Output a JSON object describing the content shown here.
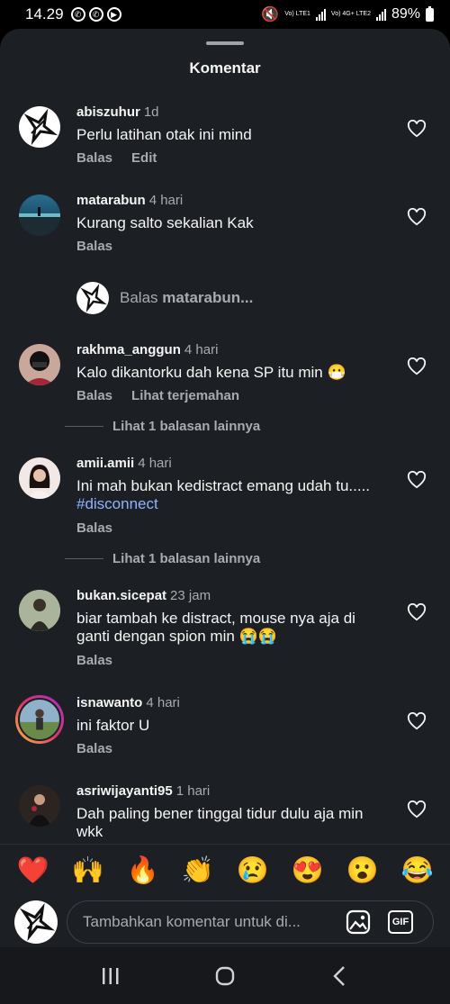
{
  "status_bar": {
    "time": "14.29",
    "battery": "89%",
    "net_label_1": "Vo) LTE1",
    "net_label_2": "Vo) 4G+ LTE2"
  },
  "sheet": {
    "title": "Komentar"
  },
  "comments": [
    {
      "username": "abiszuhur",
      "time": "1d",
      "text": "Perlu latihan otak ini mind",
      "actions": [
        "Balas",
        "Edit"
      ]
    },
    {
      "username": "matarabun",
      "time": "4 hari",
      "text": "Kurang salto sekalian Kak",
      "actions": [
        "Balas"
      ]
    },
    {
      "username": "rakhma_anggun",
      "time": "4 hari",
      "text": "Kalo dikantorku dah kena SP itu min 😷",
      "actions": [
        "Balas",
        "Lihat terjemahan"
      ]
    },
    {
      "username": "amii.amii",
      "time": "4 hari",
      "text_before": "Ini mah bukan kedistract emang udah tu..... ",
      "hashtag": "#disconnect",
      "actions": [
        "Balas"
      ]
    },
    {
      "username": "bukan.sicepat",
      "time": "23 jam",
      "text": "biar tambah ke distract, mouse nya aja di ganti dengan spion min 😭😭",
      "actions": [
        "Balas"
      ]
    },
    {
      "username": "isnawanto",
      "time": "4 hari",
      "text": "ini faktor U",
      "actions": [
        "Balas"
      ]
    },
    {
      "username": "asriwijayanti95",
      "time": "1 hari",
      "text": "Dah paling bener tinggal tidur dulu aja min wkk",
      "actions": []
    }
  ],
  "reply_prompt": {
    "prefix": "Balas ",
    "username": "matarabun..."
  },
  "more_replies": [
    "Lihat 1 balasan lainnya",
    "Lihat 1 balasan lainnya"
  ],
  "emojis": [
    "❤️",
    "🙌",
    "🔥",
    "👏",
    "😢",
    "😍",
    "😮",
    "😂"
  ],
  "composer": {
    "placeholder": "Tambahkan komentar untuk di...",
    "gif_label": "GIF"
  },
  "colors": {
    "sheet_bg": "#1c1f24",
    "muted": "#a8abb0",
    "hashtag": "#8fb3ff"
  }
}
